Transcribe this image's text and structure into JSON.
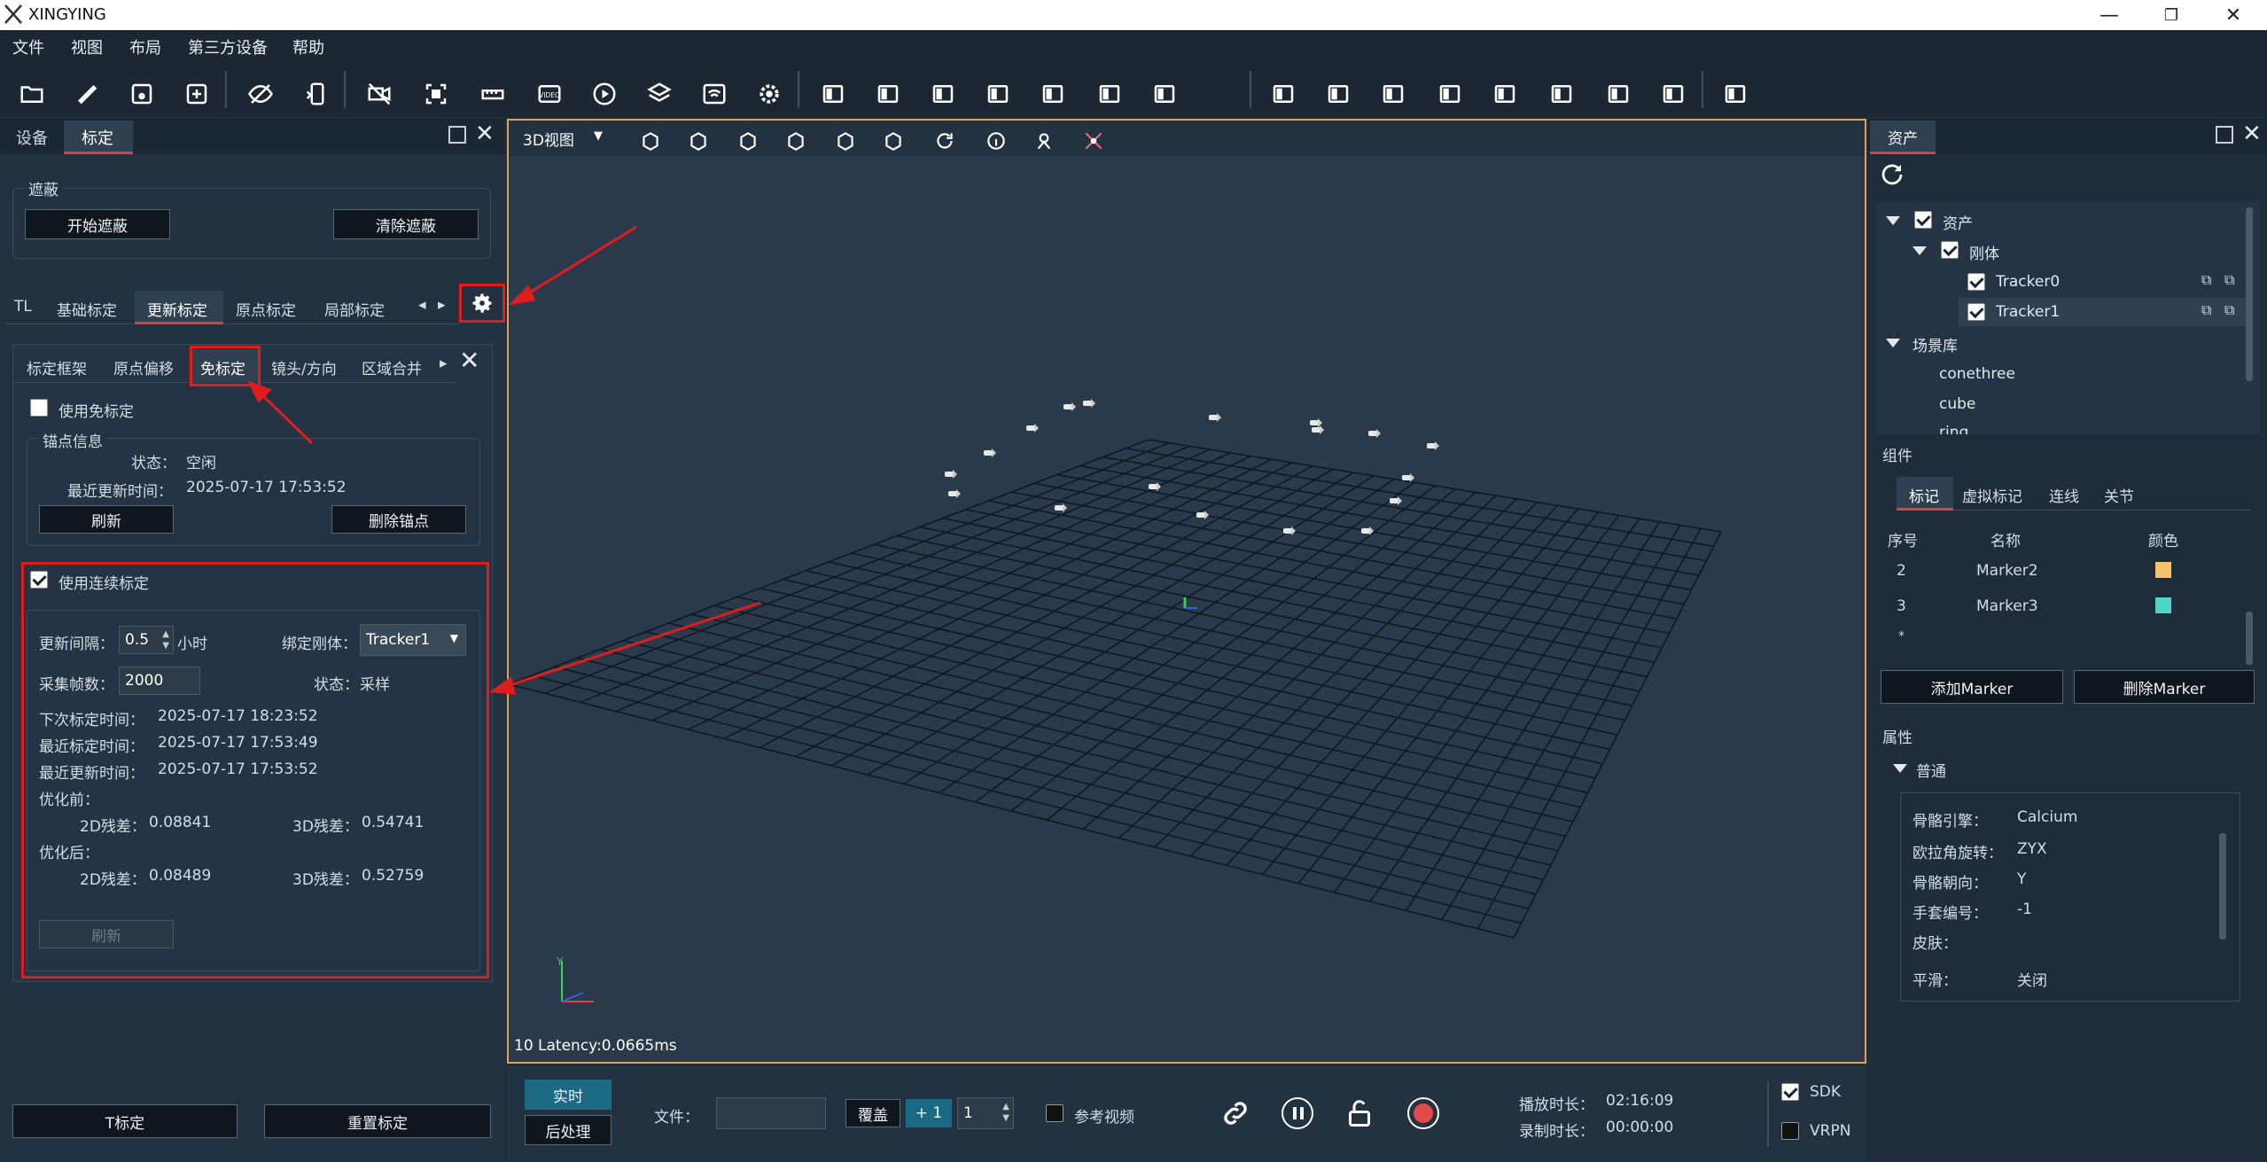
{
  "app": {
    "title": "XINGYING"
  },
  "menu": [
    "文件",
    "视图",
    "布局",
    "第三方设备",
    "帮助"
  ],
  "toolbar": {
    "icons": [
      "folder-open-icon",
      "ruler-icon",
      "save-icon",
      "save-as-icon",
      "eye-off-icon",
      "device-swap-icon",
      "video-off-icon",
      "fit-view-icon",
      "measure-icon",
      "video-icon",
      "play-circle-icon",
      "layers-icon",
      "wifi-settings-icon",
      "settings-icon",
      "monitor-icon",
      "split-horizontal-icon",
      "split-vertical-icon",
      "layout-a-icon",
      "layout-b-icon",
      "layout-c-icon",
      "layout-grid-icon",
      "export-icon",
      "2d-icon",
      "3d-icon",
      "gauge-icon",
      "graph-icon",
      "bar-chart-icon",
      "vm-icon",
      "document-icon",
      "axis-icon"
    ]
  },
  "left": {
    "tabs": [
      "设备",
      "标定"
    ],
    "mask_group": {
      "title": "遮蔽",
      "start": "开始遮蔽",
      "clear": "清除遮蔽"
    },
    "calib_tabs": [
      "TL",
      "基础标定",
      "更新标定",
      "原点标定",
      "局部标定"
    ],
    "sub_tabs": [
      "标定框架",
      "原点偏移",
      "免标定",
      "镜头/方向",
      "区域合并"
    ],
    "use_free": "使用免标定",
    "anchor": {
      "title": "锚点信息",
      "status_label": "状态：",
      "status": "空闲",
      "last_update_label": "最近更新时间：",
      "last_update": "2025-07-17 17:53:52",
      "refresh": "刷新",
      "delete": "删除锚点"
    },
    "continuous": {
      "title": "使用连续标定",
      "interval_label": "更新间隔：",
      "interval": "0.5",
      "interval_unit": "小时",
      "bind_label": "绑定刚体：",
      "bind_value": "Tracker1",
      "frames_label": "采集帧数：",
      "frames": "2000",
      "status_label": "状态：",
      "status": "采样",
      "next_label": "下次标定时间：",
      "next": "2025-07-17 18:23:52",
      "last_calib_label": "最近标定时间：",
      "last_calib": "2025-07-17 17:53:49",
      "last_update_label": "最近更新时间：",
      "last_update": "2025-07-17 17:53:52",
      "before_label": "优化前：",
      "before_2d_label": "2D残差：",
      "before_2d": "0.08841",
      "before_3d_label": "3D残差：",
      "before_3d": "0.54741",
      "after_label": "优化后：",
      "after_2d_label": "2D残差：",
      "after_2d": "0.08489",
      "after_3d_label": "3D残差：",
      "after_3d": "0.52759",
      "refresh": "刷新"
    },
    "bottom": {
      "t_calib": "T标定",
      "reset_calib": "重置标定"
    }
  },
  "viewport": {
    "mode": "3D视图",
    "latency": "10 Latency:0.0665ms",
    "axis_y": "Y"
  },
  "right": {
    "tab": "资产",
    "tree": [
      {
        "label": "资产"
      },
      {
        "label": "刚体"
      },
      {
        "label": "Tracker0"
      },
      {
        "label": "Tracker1"
      },
      {
        "label": "场景库"
      },
      {
        "label": "conethree"
      },
      {
        "label": "cube"
      },
      {
        "label": "ring"
      }
    ],
    "components_title": "组件",
    "comp_tabs": [
      "标记",
      "虚拟标记",
      "连线",
      "关节"
    ],
    "table_headers": [
      "序号",
      "名称",
      "颜色"
    ],
    "rows": [
      {
        "idx": "2",
        "name": "Marker2",
        "color": "#f5c36b"
      },
      {
        "idx": "3",
        "name": "Marker3",
        "color": "#4fd6c8"
      }
    ],
    "row_placeholder": "*",
    "add_marker": "添加Marker",
    "delete_marker": "删除Marker",
    "props_title": "属性",
    "props_group": "普通",
    "props": [
      {
        "k": "骨骼引擎：",
        "v": "Calcium"
      },
      {
        "k": "欧拉角旋转：",
        "v": "ZYX"
      },
      {
        "k": "骨骼朝向：",
        "v": "Y"
      },
      {
        "k": "手套编号：",
        "v": "-1"
      },
      {
        "k": "皮肤：",
        "v": ""
      },
      {
        "k": "平滑：",
        "v": "关闭"
      }
    ]
  },
  "bottom": {
    "realtime": "实时",
    "postprocess": "后处理",
    "file_label": "文件：",
    "overwrite": "覆盖",
    "plus_one": "+ 1",
    "spin_value": "1",
    "ref_video": "参考视频",
    "play_duration_label": "播放时长：",
    "play_duration": "02:16:09",
    "rec_duration_label": "录制时长：",
    "rec_duration": "00:00:00",
    "sdk": "SDK",
    "vrpn": "VRPN"
  }
}
